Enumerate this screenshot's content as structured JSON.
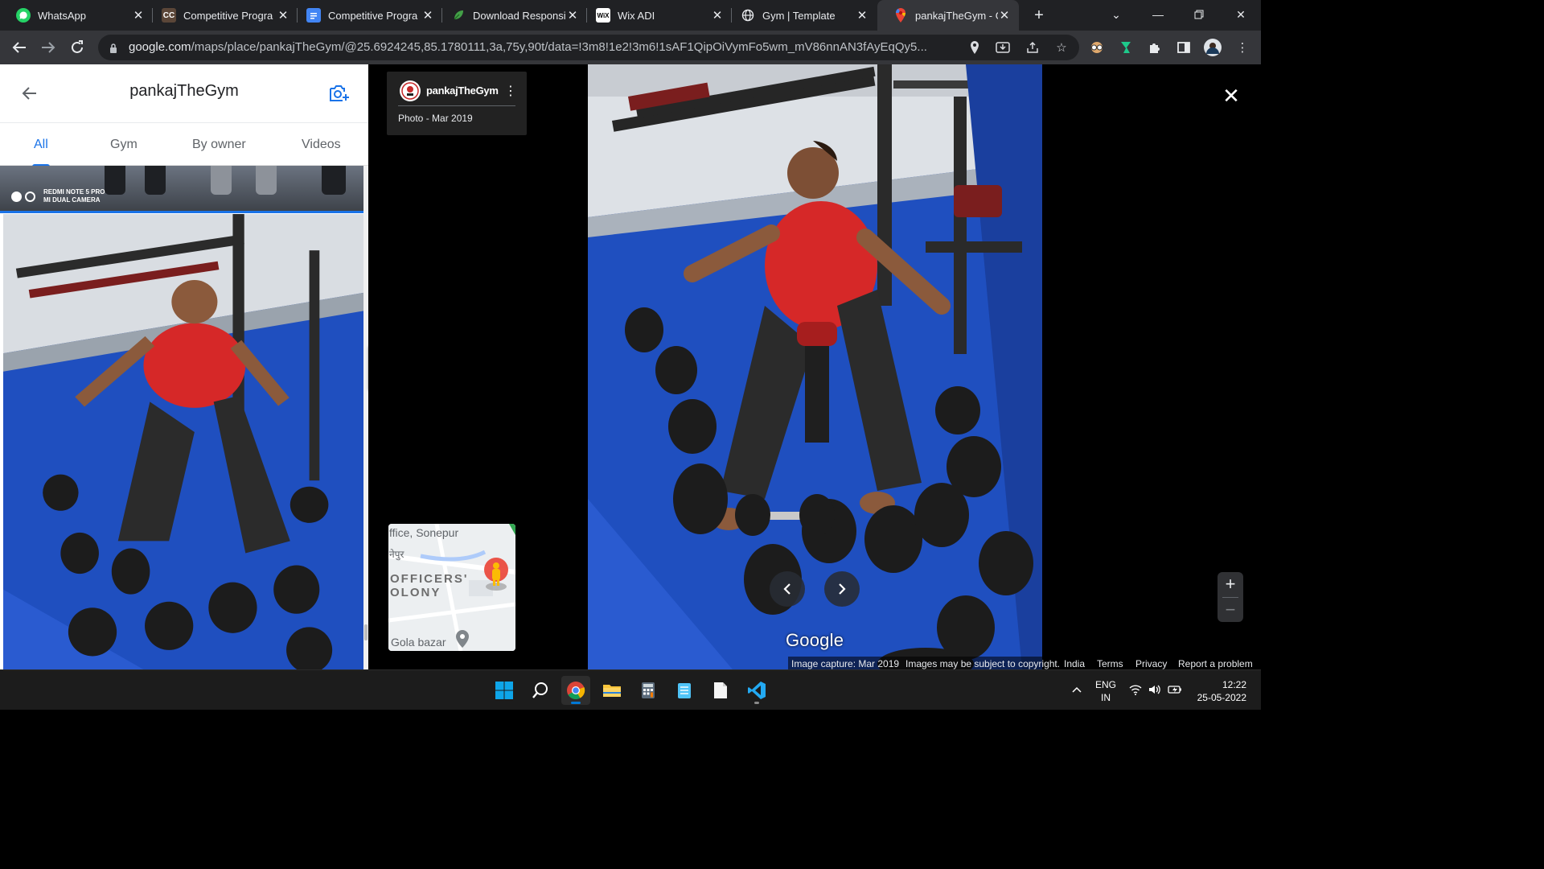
{
  "browser": {
    "tabs": [
      {
        "title": "WhatsApp",
        "favicon": "whatsapp-icon",
        "color": "#25d366"
      },
      {
        "title": "Competitive Progra",
        "favicon": "cc-icon",
        "color": "#5b4638"
      },
      {
        "title": "Competitive Progra",
        "favicon": "docs-icon",
        "color": "#4285f4"
      },
      {
        "title": "Download Responsi",
        "favicon": "leaf-icon",
        "color": "#43a047"
      },
      {
        "title": "Wix ADI",
        "favicon": "wix-icon",
        "color": "#ffffff"
      },
      {
        "title": "Gym | Template",
        "favicon": "globe-icon",
        "color": "#e8eaed"
      },
      {
        "title": "pankajTheGym - Go",
        "favicon": "maps-pin-icon",
        "color": "#ea4335",
        "active": true
      }
    ],
    "url_host": "google.com",
    "url_path": "/maps/place/pankajTheGym/@25.6924245,85.1780111,3a,75y,90t/data=!3m8!1e2!3m6!1sAF1QipOiVymFo5wm_mV86nnAN3fAyEqQy5..."
  },
  "place": {
    "title": "pankajTheGym",
    "tabs": [
      "All",
      "Gym",
      "By owner",
      "Videos"
    ],
    "active_tab": "All",
    "thumb_watermark_line1": "REDMI NOTE 5 PRO",
    "thumb_watermark_line2": "MI DUAL CAMERA"
  },
  "viewer": {
    "contributor": "pankajTheGym",
    "photo_date": "Photo - Mar 2019",
    "minimap_labels": {
      "office": "ffice, Sonepur",
      "hindi": "नेपुर",
      "officers1": "OFFICERS'",
      "officers2": "OLONY",
      "gola": "Gola bazar"
    },
    "brand": "Google",
    "footer": {
      "capture": "Image capture: Mar 2019",
      "copyright": "Images may be subject to copyright.",
      "country": "India",
      "terms": "Terms",
      "privacy": "Privacy",
      "report": "Report a problem"
    },
    "zoom_in": "+",
    "zoom_out": "−"
  },
  "taskbar": {
    "lang_line1": "ENG",
    "lang_line2": "IN",
    "time": "12:22",
    "date": "25-05-2022"
  }
}
